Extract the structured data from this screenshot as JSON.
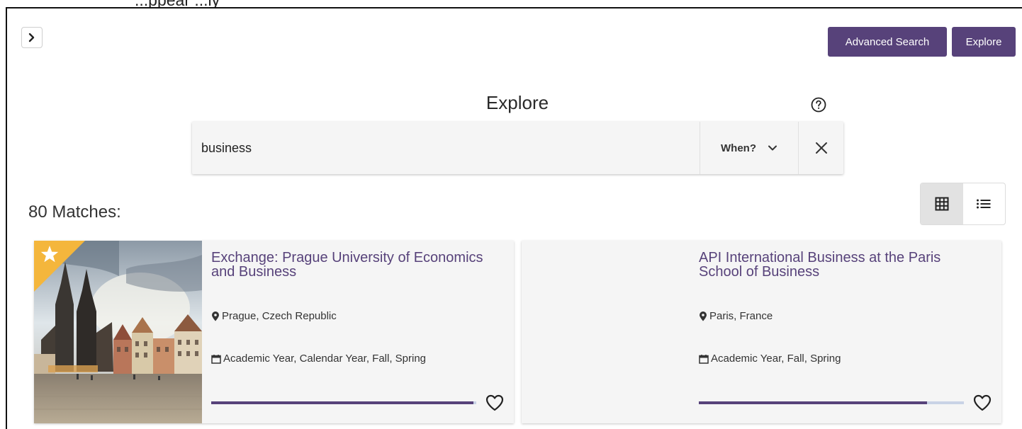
{
  "top_note": "...ppear   ...ly",
  "header": {
    "advanced_search_label": "Advanced Search",
    "explore_button_label": "Explore"
  },
  "explore_title": "Explore",
  "search": {
    "value": "business",
    "when_label": "When?"
  },
  "results": {
    "matches_label": "80 Matches:"
  },
  "view_toggle": {
    "selected": "grid"
  },
  "cards": [
    {
      "title": "Exchange: Prague University of Economics and Business",
      "location": "Prague, Czech Republic",
      "terms": "Academic Year, Calendar Year, Fall, Spring",
      "featured": true,
      "progress": 0.99
    },
    {
      "title": "API International Business at the Paris School of Business",
      "location": "Paris, France",
      "terms": "Academic Year, Fall, Spring",
      "featured": false,
      "progress": 0.86
    }
  ],
  "colors": {
    "brand": "#57427a",
    "bar_track": "#c9d3e6",
    "star_badge": "#f4b63c"
  }
}
